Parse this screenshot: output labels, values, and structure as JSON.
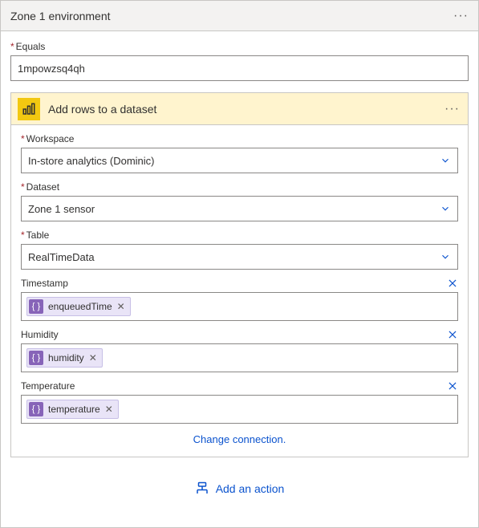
{
  "header": {
    "title": "Zone 1 environment"
  },
  "equals": {
    "label": "Equals",
    "value": "1mpowzsq4qh"
  },
  "action": {
    "title": "Add rows to a dataset",
    "icon_name": "powerbi-icon",
    "workspace": {
      "label": "Workspace",
      "value": "In-store analytics (Dominic)"
    },
    "dataset": {
      "label": "Dataset",
      "value": "Zone 1 sensor"
    },
    "table": {
      "label": "Table",
      "value": "RealTimeData"
    },
    "tokenFields": [
      {
        "label": "Timestamp",
        "token": "enqueuedTime"
      },
      {
        "label": "Humidity",
        "token": "humidity"
      },
      {
        "label": "Temperature",
        "token": "temperature"
      }
    ],
    "change_connection": "Change connection."
  },
  "footer": {
    "add_action": "Add an action"
  }
}
